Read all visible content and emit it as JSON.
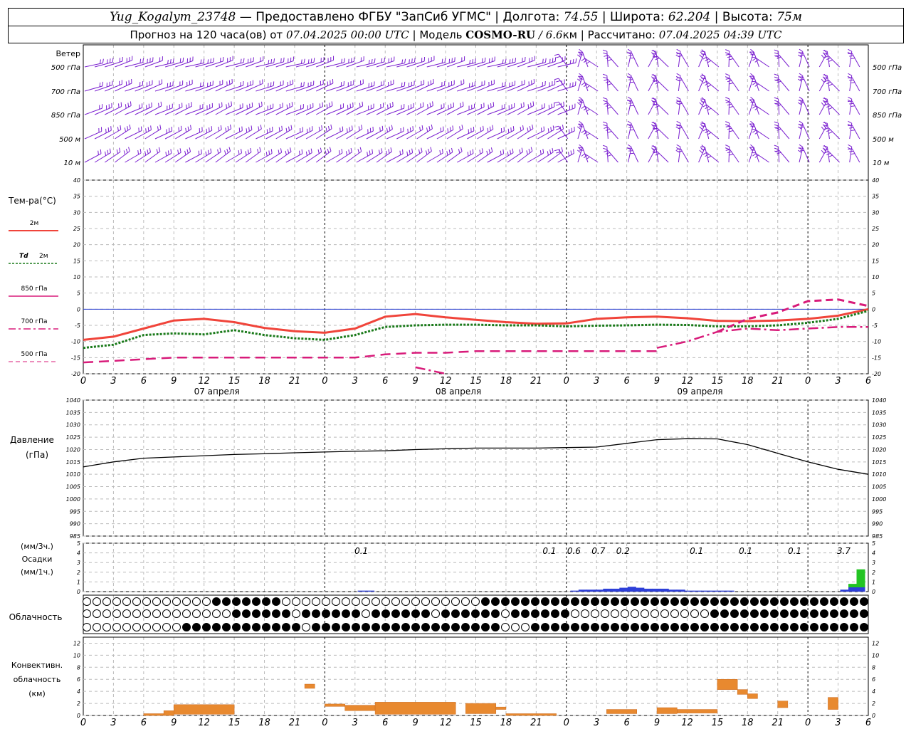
{
  "header": {
    "station": "Yug_Kogalym_23748",
    "dash": " — ",
    "provider": "Предоставлено ФГБУ \"ЗапСиб УГМС\"",
    "lon_label": "Долгота:",
    "lon_value": "74.55",
    "lat_label": "Широта:",
    "lat_value": "62.204",
    "alt_label": "Высота:",
    "alt_value": "75м",
    "forecast_prefix": "Прогноз на 120 часа(ов) от",
    "forecast_start": "07.04.2025 00:00 UTC",
    "model_label": "Модель",
    "model_name": "COSMO-RU",
    "model_res": "/ 6.6",
    "model_res_unit": "км",
    "calc_label": "Рассчитано:",
    "calc_time": "07.04.2025 04:39 UTC",
    "sep": "|"
  },
  "labels": {
    "wind": "Ветер",
    "wind_levels": [
      "500 гПа",
      "700 гПа",
      "850 гПа",
      "500 м",
      "10 м"
    ],
    "temp": "Тем-ра(°С)",
    "legend_2m": "2м",
    "legend_td": "Td",
    "legend_td_2m": "2м",
    "legend_850": "850 гПа",
    "legend_700": "700 гПа",
    "legend_500": "500 гПа",
    "pressure": "Давление",
    "pressure_unit": "(гПа)",
    "precip_top": "(мм/3ч.)",
    "precip_mid": "Осадки",
    "precip_bot": "(мм/1ч.)",
    "cloud": "Облачность",
    "conv1": "Конвективн.",
    "conv2": "облачность",
    "conv3": "(км)"
  },
  "colors": {
    "t2m": "#f0443a",
    "td": "#1a7a1a",
    "p850": "#d81b7a",
    "p700": "#d81b7a",
    "p500": "#d81b7a",
    "wind": "#7a1fd0",
    "zero": "#2a3fd0",
    "pressure": "#000000",
    "precip_blue": "#2d3fd8",
    "precip_green": "#22c422",
    "conv": "#e8892f"
  },
  "chart_data": [
    {
      "type": "line",
      "title": "Температура",
      "ylim": [
        -20,
        40
      ],
      "y_ticks": [
        -20,
        -15,
        -10,
        -5,
        0,
        5,
        10,
        15,
        20,
        25,
        30,
        35,
        40
      ],
      "x_ticks": [
        "0",
        "3",
        "6",
        "9",
        "12",
        "15",
        "18",
        "21",
        "0",
        "3",
        "6",
        "9",
        "12",
        "15",
        "18",
        "21",
        "0",
        "3",
        "6",
        "9",
        "12",
        "15",
        "18",
        "21",
        "0",
        "3",
        "6"
      ],
      "day_labels": [
        "07 апреля",
        "08 апреля",
        "09 апреля"
      ],
      "x_hours": [
        0,
        3,
        6,
        9,
        12,
        15,
        18,
        21,
        24,
        27,
        30,
        33,
        36,
        39,
        42,
        45,
        48,
        51,
        54,
        57,
        60,
        63,
        66,
        69,
        72,
        75,
        78
      ],
      "series": [
        {
          "name": "2м",
          "style": "solid",
          "values": [
            -9.5,
            -8.5,
            -6,
            -3.5,
            -3,
            -4,
            -5.8,
            -6.8,
            -7.3,
            -6,
            -2.3,
            -1.5,
            -2.5,
            -3.3,
            -4,
            -4.5,
            -4.4,
            -3,
            -2.5,
            -2.3,
            -2.8,
            -3.6,
            -3.7,
            -3.5,
            -3,
            -2,
            0
          ]
        },
        {
          "name": "Td 2м",
          "style": "dotted",
          "values": [
            -12,
            -11,
            -8,
            -7.5,
            -7.8,
            -6.5,
            -8,
            -9,
            -9.5,
            -8,
            -5.5,
            -5,
            -4.8,
            -4.8,
            -5,
            -5,
            -5.3,
            -5.1,
            -5,
            -4.8,
            -4.9,
            -5.3,
            -5.3,
            -5,
            -4.2,
            -3,
            -0.5
          ]
        },
        {
          "name": "850 гПа",
          "style": "dashed",
          "values": [
            null,
            null,
            null,
            null,
            null,
            null,
            null,
            null,
            null,
            null,
            null,
            null,
            null,
            null,
            null,
            null,
            null,
            null,
            null,
            null,
            null,
            -7,
            -3,
            -1,
            2.5,
            3,
            1
          ]
        },
        {
          "name": "700 гПа",
          "style": "dashdot",
          "values": [
            null,
            null,
            null,
            null,
            null,
            null,
            null,
            null,
            null,
            null,
            null,
            -18,
            -20,
            null,
            null,
            null,
            null,
            null,
            null,
            -12,
            -10,
            -7,
            -6,
            -6.5,
            -6,
            -5.5,
            -5.5
          ]
        },
        {
          "name": "500 гПа",
          "style": "longdash",
          "values": [
            -16.5,
            -16,
            -15.5,
            -15,
            -15,
            -15,
            -15,
            -15,
            -15,
            -15,
            -14,
            -13.5,
            -13.5,
            -13,
            -13,
            -13,
            -13,
            -13,
            -13,
            -13,
            null,
            null,
            null,
            null,
            null,
            null,
            null
          ]
        }
      ]
    },
    {
      "type": "line",
      "title": "Давление",
      "ylim": [
        985,
        1040
      ],
      "y_ticks": [
        985,
        990,
        995,
        1000,
        1005,
        1010,
        1015,
        1020,
        1025,
        1030,
        1035,
        1040
      ],
      "x_hours": [
        0,
        3,
        6,
        9,
        12,
        15,
        18,
        21,
        24,
        27,
        30,
        33,
        36,
        39,
        42,
        45,
        48,
        51,
        54,
        57,
        60,
        63,
        66,
        69,
        72,
        75,
        78
      ],
      "series": [
        {
          "name": "Давление",
          "values": [
            1013,
            1015,
            1016.5,
            1017,
            1017.5,
            1018,
            1018.3,
            1018.7,
            1019,
            1019.3,
            1019.5,
            1020,
            1020.3,
            1020.6,
            1020.6,
            1020.6,
            1020.8,
            1021,
            1022.5,
            1024,
            1024.4,
            1024.3,
            1022,
            1018.5,
            1015,
            1012,
            1010
          ]
        }
      ]
    },
    {
      "type": "bar",
      "title": "Осадки",
      "ylim": [
        0,
        5
      ],
      "y_ticks": [
        0,
        1,
        2,
        3,
        4,
        5
      ],
      "annotations": [
        "0.1",
        "0.1",
        "0.6",
        "0.7",
        "0.2",
        "0.1",
        "0.1",
        "0.1",
        "3.7"
      ],
      "annotation_hours": [
        34,
        57,
        60,
        63,
        66,
        75,
        81,
        87,
        93
      ],
      "blue_hours": [
        34,
        35,
        60,
        61,
        62,
        63,
        64,
        65,
        66,
        67,
        68,
        69,
        70,
        71,
        72,
        73,
        74,
        75,
        76,
        77,
        78,
        79,
        93,
        94,
        95
      ],
      "blue_values": [
        0.1,
        0.1,
        0.1,
        0.2,
        0.2,
        0.2,
        0.3,
        0.3,
        0.4,
        0.5,
        0.4,
        0.3,
        0.3,
        0.3,
        0.2,
        0.2,
        0.1,
        0.1,
        0.1,
        0.1,
        0.1,
        0.1,
        0.2,
        0.5,
        0.8
      ],
      "green_hours": [
        93,
        94,
        95
      ],
      "green_values": [
        0.3,
        0.8,
        2.3
      ]
    },
    {
      "type": "bar",
      "title": "Конвективн. облачность",
      "ylim": [
        0,
        13
      ],
      "y_ticks": [
        0,
        2,
        4,
        6,
        8,
        10,
        12
      ],
      "bars": [
        {
          "from": 6,
          "to": 8,
          "lo": 0,
          "hi": 0.3
        },
        {
          "from": 8,
          "to": 9,
          "lo": 0,
          "hi": 0.8
        },
        {
          "from": 9,
          "to": 15,
          "lo": 0.2,
          "hi": 1.8
        },
        {
          "from": 22,
          "to": 23,
          "lo": 4.5,
          "hi": 5.2
        },
        {
          "from": 24,
          "to": 26,
          "lo": 1.5,
          "hi": 1.9
        },
        {
          "from": 26,
          "to": 29,
          "lo": 0.8,
          "hi": 1.7
        },
        {
          "from": 29,
          "to": 37,
          "lo": 0.2,
          "hi": 2.2
        },
        {
          "from": 38,
          "to": 41,
          "lo": 0.3,
          "hi": 2
        },
        {
          "from": 41,
          "to": 42,
          "lo": 1,
          "hi": 1.4
        },
        {
          "from": 42,
          "to": 47,
          "lo": 0,
          "hi": 0.3
        },
        {
          "from": 52,
          "to": 55,
          "lo": 0.3,
          "hi": 1
        },
        {
          "from": 57,
          "to": 59,
          "lo": 0.3,
          "hi": 1.3
        },
        {
          "from": 59,
          "to": 63,
          "lo": 0.4,
          "hi": 1
        },
        {
          "from": 63,
          "to": 65,
          "lo": 4.3,
          "hi": 6
        },
        {
          "from": 65,
          "to": 66,
          "lo": 3.5,
          "hi": 4.3
        },
        {
          "from": 66,
          "to": 67,
          "lo": 2.8,
          "hi": 3.6
        },
        {
          "from": 69,
          "to": 70,
          "lo": 1.3,
          "hi": 2.4
        },
        {
          "from": 74,
          "to": 75,
          "lo": 1,
          "hi": 3
        }
      ]
    }
  ]
}
